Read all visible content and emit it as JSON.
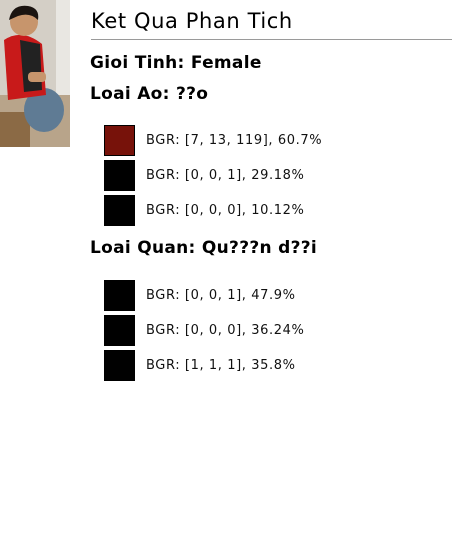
{
  "thumbnail_alt": "person photo",
  "title": "Ket Qua Phan Tich",
  "gender_line": "Gioi Tinh: Female",
  "top": {
    "heading": "Loai Ao: ??o",
    "colors": [
      {
        "hex": "#77120a",
        "label": "BGR: [7, 13, 119], 60.7%"
      },
      {
        "hex": "#000000",
        "label": "BGR: [0, 0, 1], 29.18%"
      },
      {
        "hex": "#000000",
        "label": "BGR: [0, 0, 0], 10.12%"
      }
    ]
  },
  "bottom": {
    "heading": "Loai Quan: Qu???n d??i",
    "colors": [
      {
        "hex": "#000000",
        "label": "BGR: [0, 0, 1], 47.9%"
      },
      {
        "hex": "#000000",
        "label": "BGR: [0, 0, 0], 36.24%"
      },
      {
        "hex": "#010101",
        "label": "BGR: [1, 1, 1], 35.8%"
      }
    ]
  }
}
